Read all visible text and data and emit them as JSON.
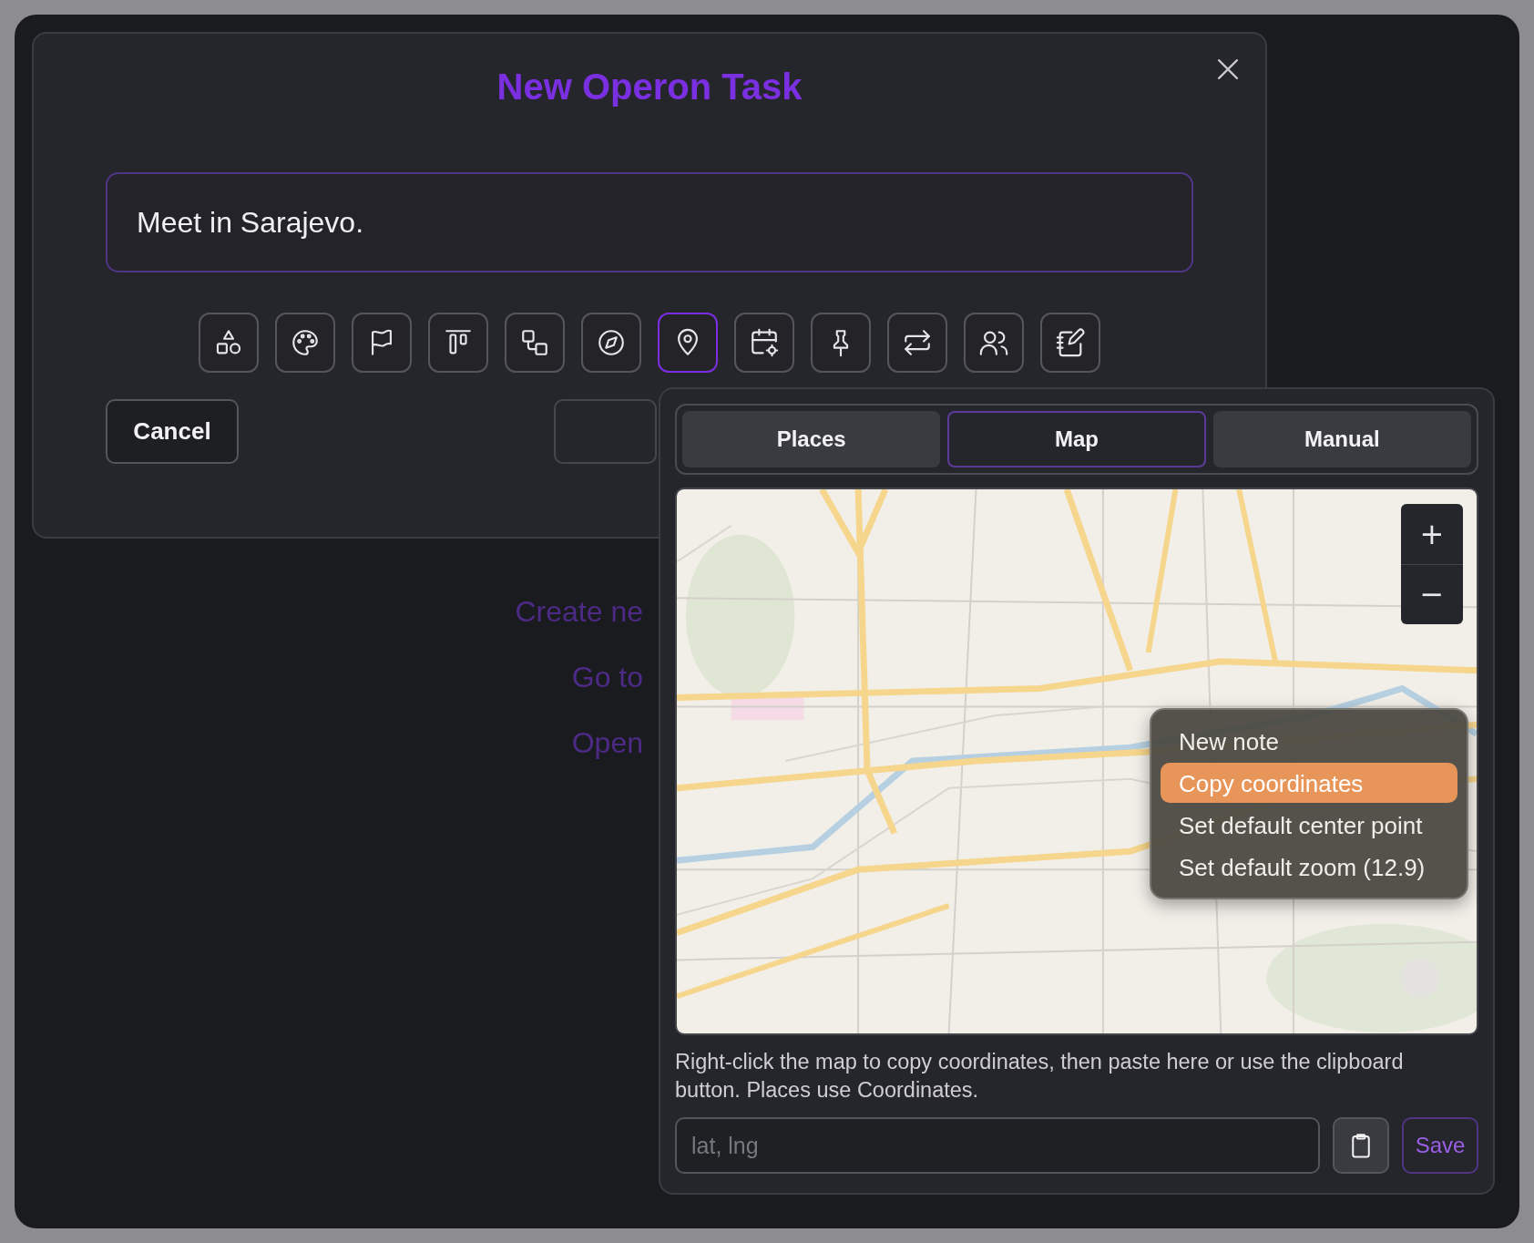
{
  "dialog": {
    "title": "New Operon Task",
    "task_input": {
      "value": "Meet in Sarajevo."
    },
    "toolbar": [
      {
        "kind": "shapes",
        "selected": false
      },
      {
        "kind": "palette",
        "selected": false
      },
      {
        "kind": "flag",
        "selected": false
      },
      {
        "kind": "align",
        "selected": false
      },
      {
        "kind": "nodes",
        "selected": false
      },
      {
        "kind": "compass",
        "selected": false
      },
      {
        "kind": "pin",
        "selected": true
      },
      {
        "kind": "calendar",
        "selected": false
      },
      {
        "kind": "pushpin",
        "selected": false
      },
      {
        "kind": "repeat",
        "selected": false
      },
      {
        "kind": "users",
        "selected": false
      },
      {
        "kind": "notebook",
        "selected": false
      }
    ],
    "cancel_button": "Cancel"
  },
  "background_links": [
    "Create ne",
    "Go to",
    "Open"
  ],
  "location_popup": {
    "tabs": [
      {
        "label": "Places",
        "selected": false
      },
      {
        "label": "Map",
        "selected": true
      },
      {
        "label": "Manual",
        "selected": false
      }
    ],
    "map": {
      "kind": "picture",
      "zoom_in": "+",
      "zoom_out": "−",
      "context_menu": [
        {
          "label": "New note",
          "selected": false
        },
        {
          "label": "Copy coordinates",
          "selected": true
        },
        {
          "label": "Set default center point",
          "selected": false
        },
        {
          "label": "Set default zoom (12.9)",
          "selected": false
        }
      ]
    },
    "hint": "Right-click the map to copy coordinates, then paste here or use the clipboard button. Places use Coordinates.",
    "coordinates_input": {
      "placeholder": "lat, lng"
    },
    "save_button": "Save"
  }
}
